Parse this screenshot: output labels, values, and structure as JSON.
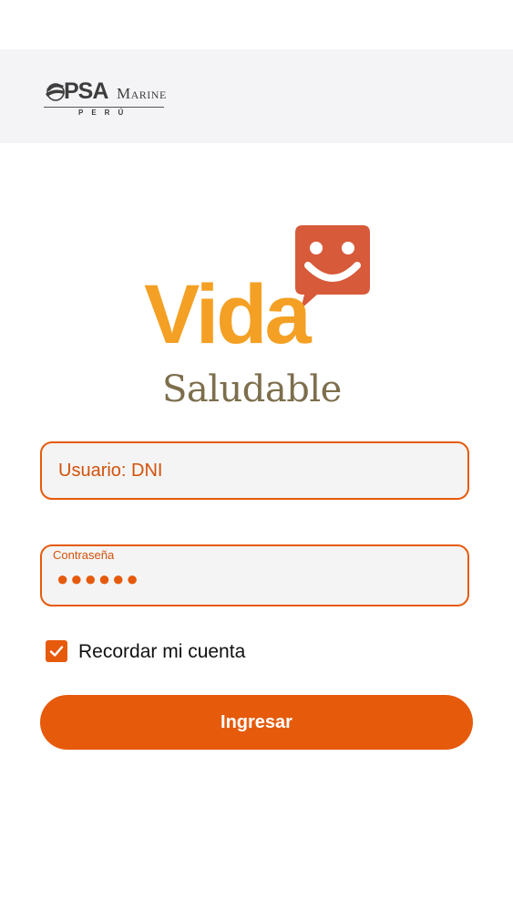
{
  "header": {
    "brand_psa": "PSA",
    "brand_marine": "Marine",
    "brand_country": "PERÚ"
  },
  "logo": {
    "word_main": "Vida",
    "word_sub": "Saludable",
    "icon": "smiley-chat-bubble-icon",
    "colors": {
      "main": "#f4a024",
      "sub": "#7d6e4c",
      "bubble": "#d75a3a"
    }
  },
  "form": {
    "username": {
      "placeholder": "Usuario: DNI",
      "value": ""
    },
    "password": {
      "label": "Contraseña",
      "masked_value": "●●●●●●"
    },
    "remember": {
      "label": "Recordar mi cuenta",
      "checked": true
    },
    "submit_label": "Ingresar"
  },
  "colors": {
    "accent": "#e65a0c",
    "header_bg": "#f4f4f6",
    "field_bg": "#f4f4f4"
  }
}
